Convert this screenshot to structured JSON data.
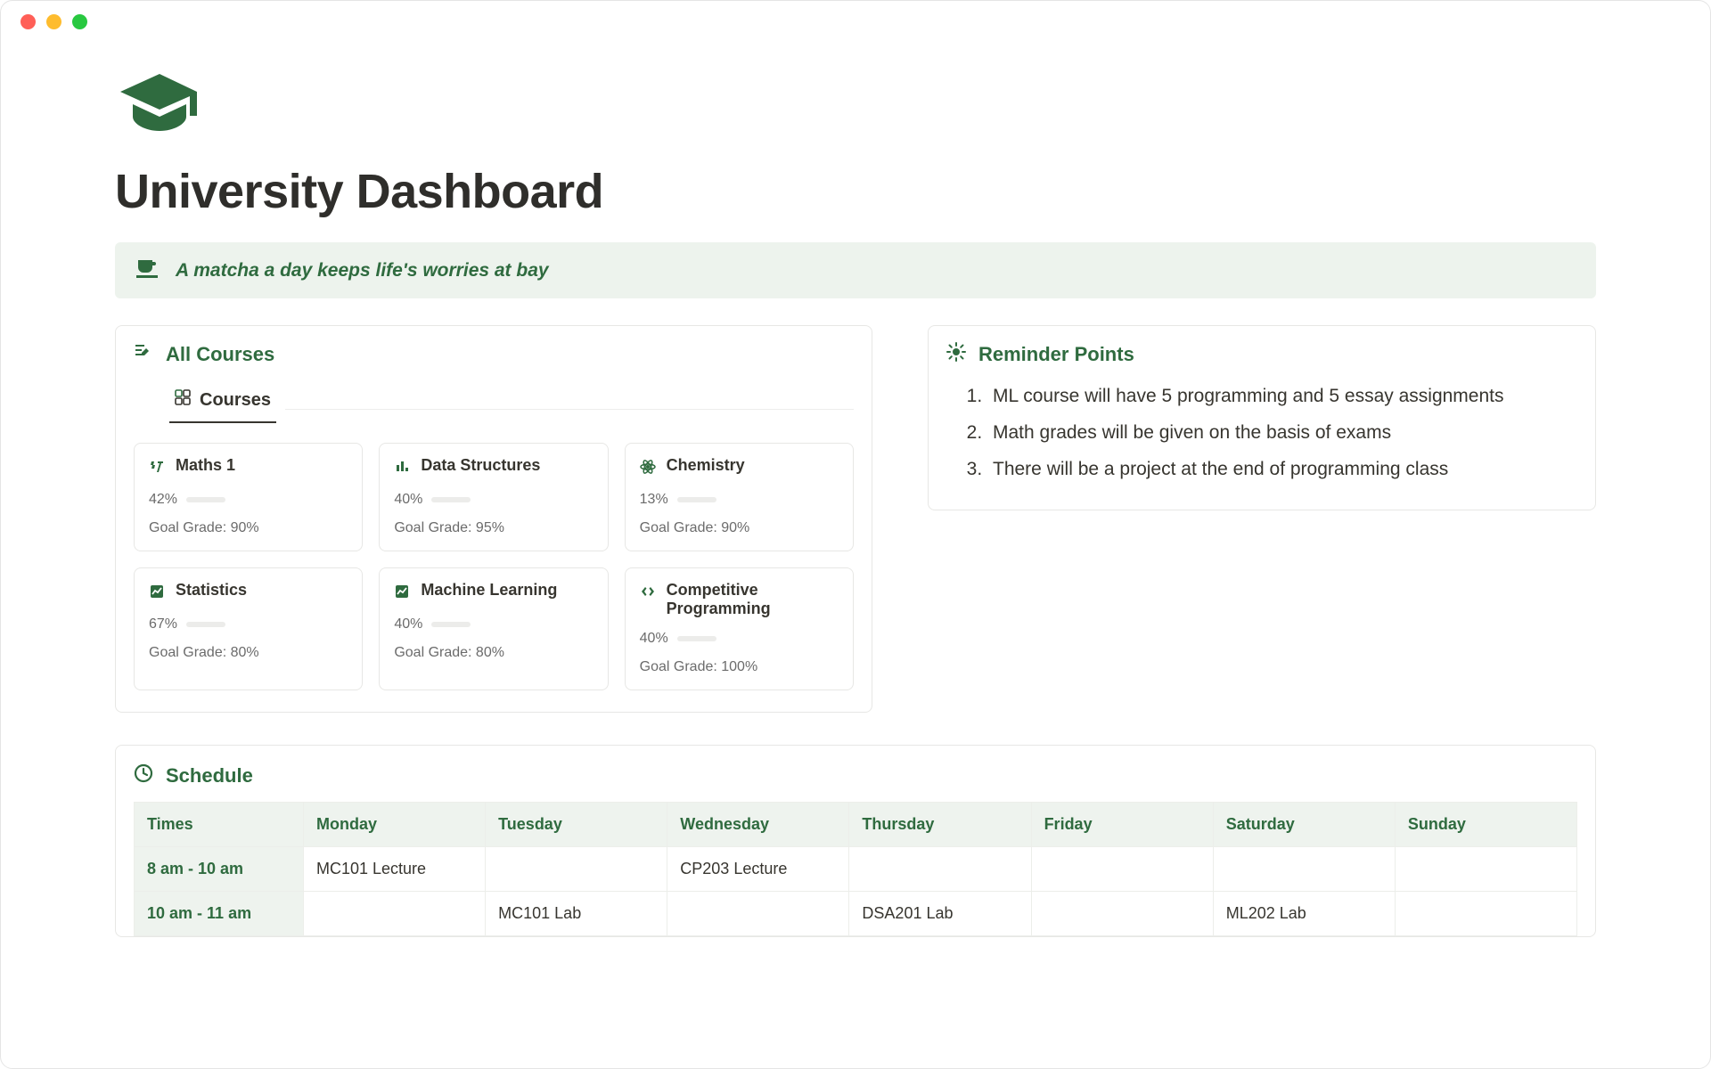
{
  "page": {
    "title": "University Dashboard",
    "quote": "A matcha a day keeps life's worries at bay"
  },
  "courses_section": {
    "title": "All Courses",
    "tab_label": "Courses",
    "items": [
      {
        "name": "Maths 1",
        "icon": "formula",
        "progress_label": "42%",
        "progress_pct": 42,
        "goal": "Goal Grade: 90%"
      },
      {
        "name": "Data Structures",
        "icon": "bars",
        "progress_label": "40%",
        "progress_pct": 40,
        "goal": "Goal Grade: 95%"
      },
      {
        "name": "Chemistry",
        "icon": "atom",
        "progress_label": "13%",
        "progress_pct": 13,
        "goal": "Goal Grade: 90%"
      },
      {
        "name": "Statistics",
        "icon": "chart",
        "progress_label": "67%",
        "progress_pct": 67,
        "goal": "Goal Grade: 80%"
      },
      {
        "name": "Machine Learning",
        "icon": "chart",
        "progress_label": "40%",
        "progress_pct": 40,
        "goal": "Goal Grade: 80%"
      },
      {
        "name": "Competitive Programming",
        "icon": "code",
        "progress_label": "40%",
        "progress_pct": 40,
        "goal": "Goal Grade: 100%"
      }
    ]
  },
  "reminders_section": {
    "title": "Reminder Points",
    "items": [
      "ML course will have 5 programming and 5 essay assignments",
      "Math grades will be given on the basis of exams",
      "There will be a project at the end of programming class"
    ]
  },
  "schedule_section": {
    "title": "Schedule",
    "headers": [
      "Times",
      "Monday",
      "Tuesday",
      "Wednesday",
      "Thursday",
      "Friday",
      "Saturday",
      "Sunday"
    ],
    "rows": [
      {
        "time": "8 am - 10 am",
        "cells": [
          "MC101 Lecture",
          "",
          "CP203 Lecture",
          "",
          "",
          "",
          ""
        ]
      },
      {
        "time": "10 am - 11 am",
        "cells": [
          "",
          "MC101 Lab",
          "",
          "DSA201 Lab",
          "",
          "ML202 Lab",
          ""
        ]
      }
    ]
  }
}
